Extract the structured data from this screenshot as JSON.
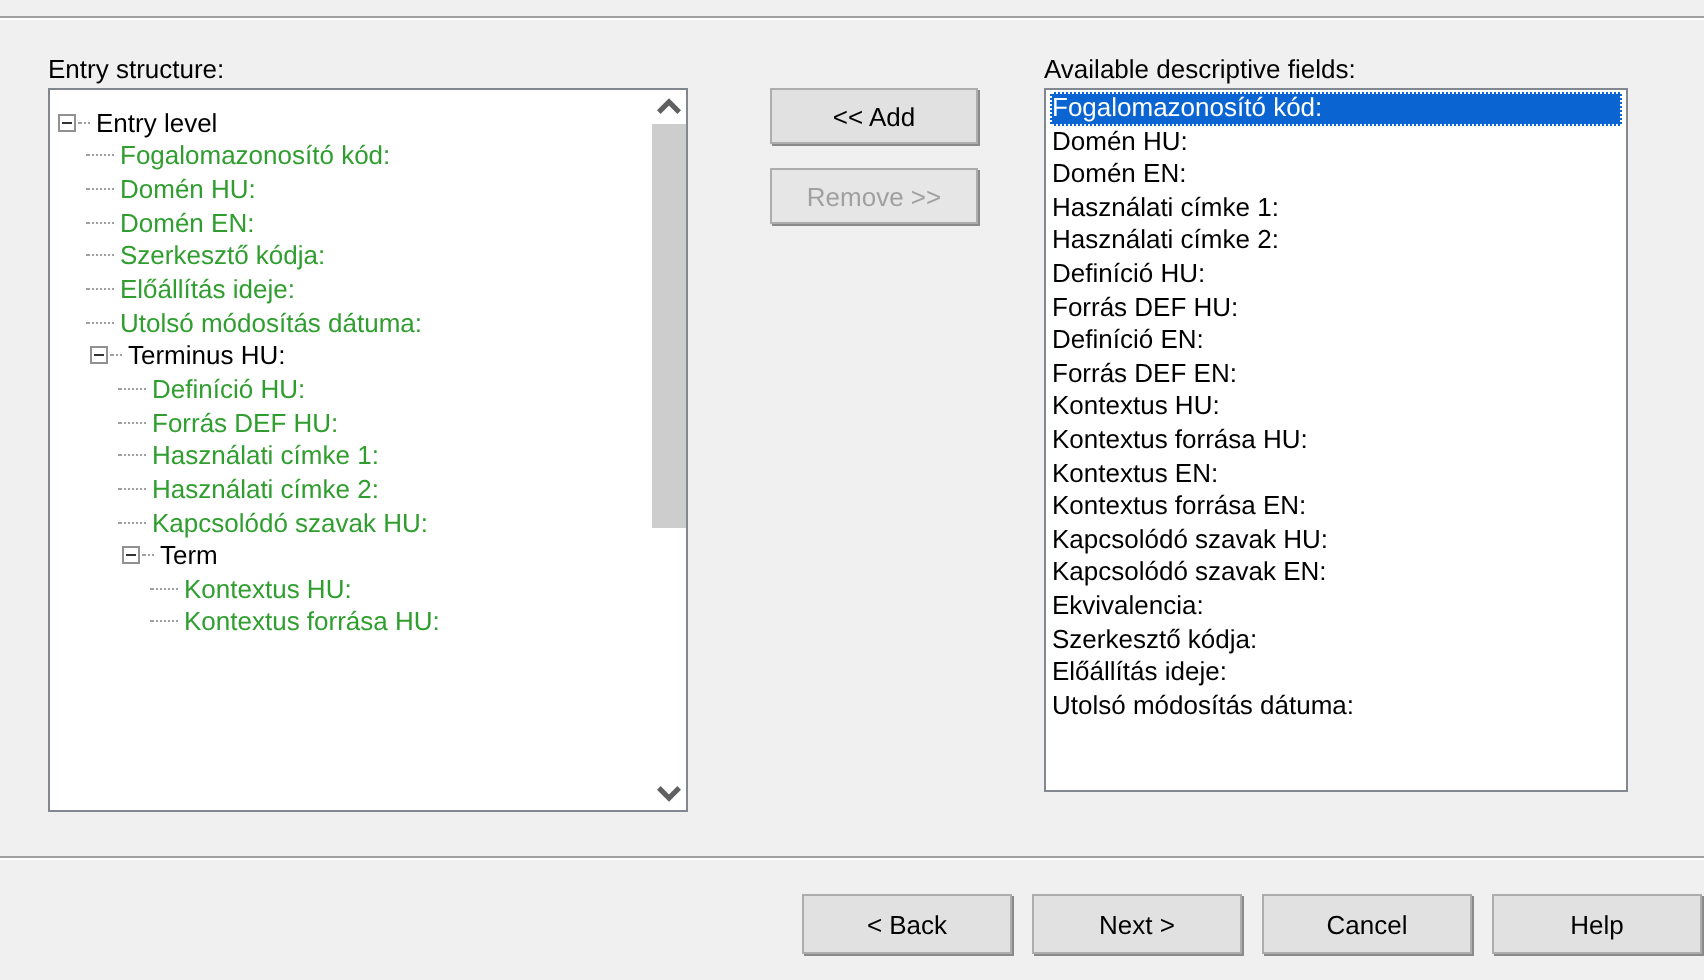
{
  "entry_structure": {
    "label": "Entry structure:",
    "tree": [
      {
        "label": "Entry level",
        "kind": "group",
        "expanded": true,
        "children": [
          {
            "label": "Fogalomazonosító kód:",
            "kind": "field"
          },
          {
            "label": "Domén HU:",
            "kind": "field"
          },
          {
            "label": "Domén EN:",
            "kind": "field"
          },
          {
            "label": "Szerkesztő kódja:",
            "kind": "field"
          },
          {
            "label": "Előállítás ideje:",
            "kind": "field"
          },
          {
            "label": "Utolsó módosítás dátuma:",
            "kind": "field"
          },
          {
            "label": "Terminus HU:",
            "kind": "group",
            "expanded": true,
            "children": [
              {
                "label": "Definíció HU:",
                "kind": "field"
              },
              {
                "label": "Forrás DEF HU:",
                "kind": "field"
              },
              {
                "label": "Használati címke 1:",
                "kind": "field"
              },
              {
                "label": "Használati címke 2:",
                "kind": "field"
              },
              {
                "label": "Kapcsolódó szavak HU:",
                "kind": "field"
              },
              {
                "label": "Term",
                "kind": "group",
                "expanded": true,
                "children": [
                  {
                    "label": "Kontextus HU:",
                    "kind": "field"
                  },
                  {
                    "label": "Kontextus forrása HU:",
                    "kind": "field"
                  }
                ]
              }
            ]
          }
        ]
      }
    ]
  },
  "middle_buttons": [
    {
      "label": "<< Add",
      "disabled": false
    },
    {
      "label": "Remove >>",
      "disabled": true
    }
  ],
  "available_fields": {
    "label": "Available descriptive fields:",
    "items": [
      {
        "label": "Fogalomazonosító kód:",
        "selected": true
      },
      {
        "label": "Domén HU:",
        "selected": false
      },
      {
        "label": "Domén EN:",
        "selected": false
      },
      {
        "label": "Használati címke 1:",
        "selected": false
      },
      {
        "label": "Használati címke 2:",
        "selected": false
      },
      {
        "label": "Definíció HU:",
        "selected": false
      },
      {
        "label": "Forrás DEF HU:",
        "selected": false
      },
      {
        "label": "Definíció EN:",
        "selected": false
      },
      {
        "label": "Forrás DEF EN:",
        "selected": false
      },
      {
        "label": "Kontextus HU:",
        "selected": false
      },
      {
        "label": "Kontextus forrása HU:",
        "selected": false
      },
      {
        "label": "Kontextus EN:",
        "selected": false
      },
      {
        "label": "Kontextus forrása EN:",
        "selected": false
      },
      {
        "label": "Kapcsolódó szavak HU:",
        "selected": false
      },
      {
        "label": "Kapcsolódó szavak EN:",
        "selected": false
      },
      {
        "label": "Ekvivalencia:",
        "selected": false
      },
      {
        "label": "Szerkesztő kódja:",
        "selected": false
      },
      {
        "label": "Előállítás ideje:",
        "selected": false
      },
      {
        "label": "Utolsó módosítás dátuma:",
        "selected": false
      }
    ]
  },
  "footer_buttons": [
    {
      "label": "< Back"
    },
    {
      "label": "Next >"
    },
    {
      "label": "Cancel"
    },
    {
      "label": "Help"
    }
  ]
}
